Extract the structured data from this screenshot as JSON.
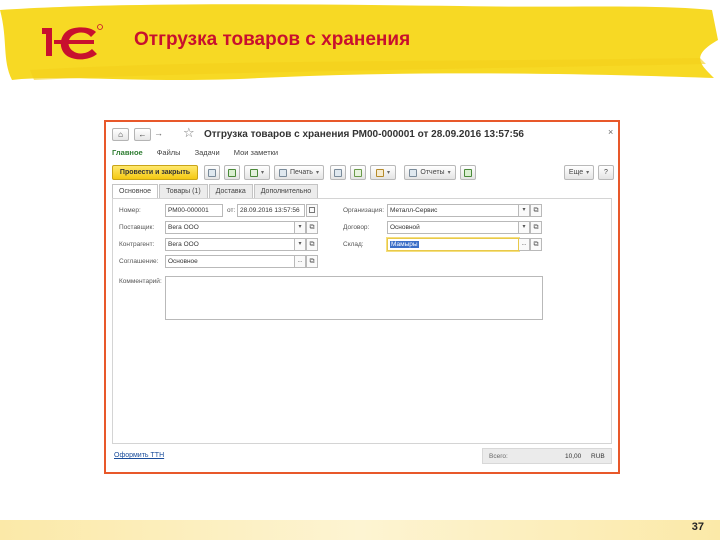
{
  "slide": {
    "title": "Отгрузка товаров с хранения",
    "page_number": "37",
    "logo_text": "1С"
  },
  "colors": {
    "accent_yellow": "#f7d924",
    "title_red": "#c8102e",
    "window_border": "#e8582a",
    "primary_button": "#f5c912",
    "link_blue": "#1a4d9b"
  },
  "window": {
    "title": "Отгрузка товаров с хранения РМ00-000001 от 28.09.2016 13:57:56",
    "nav": {
      "home_icon": "⌂",
      "back_icon": "←",
      "forward_icon": "→",
      "favorite_icon": "☆",
      "close_icon": "×"
    },
    "sections": [
      "Главное",
      "Файлы",
      "Задачи",
      "Мои заметки"
    ],
    "toolbar": {
      "post_and_close": "Провести и закрыть",
      "print": "Печать",
      "reports": "Отчеты",
      "more": "Еще",
      "help": "?",
      "dropdown_arrow": "▾"
    },
    "tabs": [
      "Основное",
      "Товары (1)",
      "Доставка",
      "Дополнительно"
    ],
    "form": {
      "number_label": "Номер:",
      "number_value": "РМ00-000001",
      "date_label": "от:",
      "date_value": "28.09.2016 13:57:56",
      "supplier_label": "Поставщик:",
      "supplier_value": "Вега ООО",
      "counterparty_label": "Контрагент:",
      "counterparty_value": "Вега ООО",
      "agreement_label": "Соглашение:",
      "agreement_value": "Основное",
      "organization_label": "Организация:",
      "organization_value": "Металл-Сервис",
      "contract_label": "Договор:",
      "contract_value": "Основной",
      "warehouse_label": "Склад:",
      "warehouse_value": "Мамыры",
      "comment_label": "Комментарий:",
      "comment_value": "",
      "select_arrow": "▾",
      "choice_dots": "...",
      "open_glyph": "⧉"
    },
    "footer": {
      "ttn_link": "Оформить ТТН",
      "total_label": "Всего:",
      "total_value": "10,00",
      "currency": "RUB"
    }
  }
}
